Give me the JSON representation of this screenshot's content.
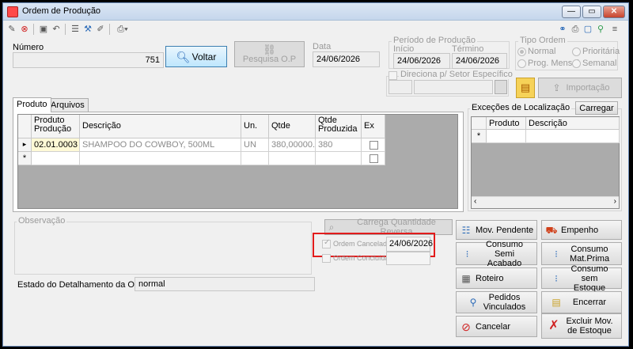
{
  "window": {
    "title": "Ordem de Produção",
    "controls": {
      "minimize": "—",
      "maximize": "▭",
      "close": "✕"
    }
  },
  "toolbar": {
    "left_icons": [
      "edit-icon",
      "cancel-icon",
      "save-icon",
      "undo-icon",
      "list-icon",
      "tools-icon",
      "brush-icon",
      "print-icon"
    ],
    "right_icons": [
      "link-icon",
      "print-icon",
      "window-icon",
      "info-icon",
      "menu-icon"
    ]
  },
  "header": {
    "numero_label": "Número",
    "numero_value": "751",
    "voltar_label": "Voltar",
    "pesquisa_label": "Pesquisa O.P",
    "data_label": "Data",
    "data_value": "24/06/2026",
    "periodo_label": "Período de Produção",
    "inicio_label": "Início",
    "inicio_value": "24/06/2026",
    "termino_label": "Término",
    "termino_value": "24/06/2026",
    "tipo_ordem_label": "Tipo Ordem",
    "tipo_normal": "Normal",
    "tipo_prioritaria": "Prioritária",
    "tipo_prog_mensal": "Prog. Mensal",
    "tipo_semanal": "Semanal",
    "direciona_label": "Direciona p/ Setor Específico",
    "importacao_label": "Importação"
  },
  "tabs": {
    "produto": "Produto",
    "arquivos": "Arquivos"
  },
  "grid": {
    "columns": [
      "Produto Produção",
      "Descrição",
      "Un.",
      "Qtde",
      "Qtde Produzida",
      "Ex"
    ],
    "rows": [
      {
        "produto": "02.01.0003",
        "descricao": "SHAMPOO DO COWBOY, 500ML",
        "un": "UN",
        "qtde": "380,00000...",
        "qtde_produzida": "380"
      }
    ],
    "row_marker": "▸",
    "new_row_marker": "*"
  },
  "excecoes": {
    "title": "Exceções de Localização",
    "carregar_label": "Carregar",
    "columns": [
      "Produto",
      "Descrição"
    ],
    "new_row_marker": "*"
  },
  "bottom": {
    "observacao_label": "Observação",
    "carrega_qtd_reversa": "Carrega Quantidade Reversa",
    "ordem_cancelada_label": "Ordem Cancelada",
    "ordem_cancelada_date": "24/06/2026",
    "ordem_concluida_label": "Ordem Concluída",
    "estado_label": "Estado do Detalhamento da OP:",
    "estado_value": "normal"
  },
  "actions": {
    "mov_pendente": "Mov. Pendente",
    "empenho": "Empenho",
    "consumo_semi": "Consumo Semi Acabado",
    "consumo_mat": "Consumo Mat.Prima",
    "roteiro": "Roteiro",
    "consumo_sem_estoque": "Consumo sem Estoque",
    "pedidos_vinculados": "Pedidos Vinculados",
    "encerrar": "Encerrar",
    "cancelar": "Cancelar",
    "excluir_mov": "Excluir Mov. de Estoque"
  }
}
